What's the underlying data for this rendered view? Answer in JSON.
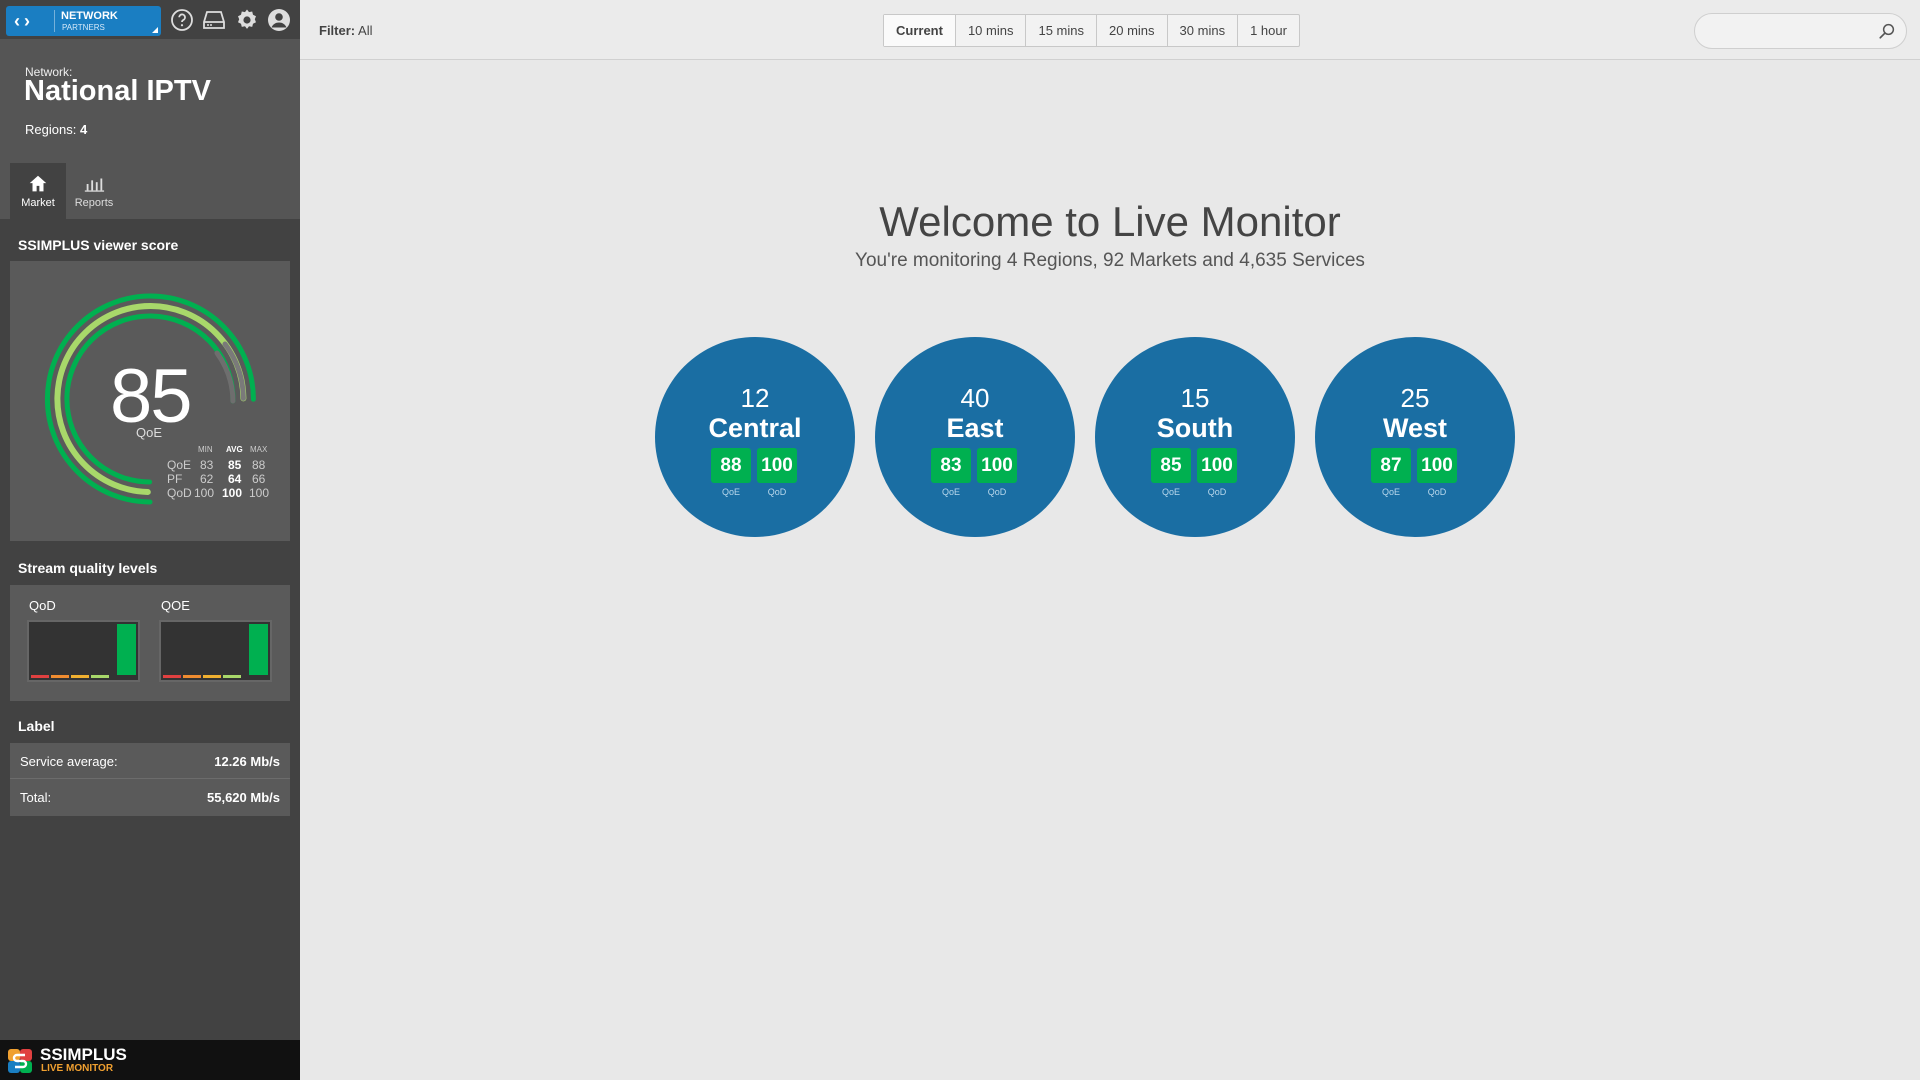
{
  "topbar": {
    "network_label": "NETWORK",
    "partners_label": "PARTNERS"
  },
  "sidebar": {
    "network_caption": "Network:",
    "network_name": "National IPTV",
    "regions_caption": "Regions:",
    "regions_count": "4",
    "tabs": [
      {
        "label": "Market",
        "icon": "home-icon"
      },
      {
        "label": "Reports",
        "icon": "bar-chart-icon"
      }
    ],
    "score_title": "SSIMPLUS viewer score",
    "score": {
      "value": "85",
      "unit": "QoE",
      "headers": [
        "MIN",
        "AVG",
        "MAX"
      ],
      "rows": [
        {
          "label": "QoE",
          "min": "83",
          "avg": "85",
          "max": "88"
        },
        {
          "label": "PF",
          "min": "62",
          "avg": "64",
          "max": "66"
        },
        {
          "label": "QoD",
          "min": "100",
          "avg": "100",
          "max": "100"
        }
      ]
    },
    "stream_title": "Stream quality levels",
    "stream": [
      {
        "label": "QoD"
      },
      {
        "label": "QOE"
      }
    ],
    "label_title": "Label",
    "label_rows": [
      {
        "key": "Service average:",
        "value": "12.26 Mb/s"
      },
      {
        "key": "Total:",
        "value": "55,620 Mb/s"
      }
    ],
    "brand_name": "SSIMPLUS",
    "brand_sub": "LIVE MONITOR"
  },
  "header": {
    "filter_label": "Filter:",
    "filter_value": "All",
    "time_tabs": [
      "Current",
      "10 mins",
      "15 mins",
      "20 mins",
      "30 mins",
      "1 hour"
    ],
    "active_tab": "Current",
    "search_placeholder": ""
  },
  "main": {
    "welcome_title": "Welcome to Live Monitor",
    "welcome_subtitle": "You're monitoring 4 Regions, 92 Markets and 4,635 Services",
    "regions": [
      {
        "count": "12",
        "name": "Central",
        "qoe": "88",
        "qod": "100"
      },
      {
        "count": "40",
        "name": "East",
        "qoe": "83",
        "qod": "100"
      },
      {
        "count": "15",
        "name": "South",
        "qoe": "85",
        "qod": "100"
      },
      {
        "count": "25",
        "name": "West",
        "qoe": "87",
        "qod": "100"
      }
    ],
    "qoe_caption": "QoE",
    "qod_caption": "QoD"
  },
  "colors": {
    "accent": "#1a7ec2",
    "region": "#1a6ea3",
    "good": "#00b050",
    "sidebar": "#424242"
  }
}
